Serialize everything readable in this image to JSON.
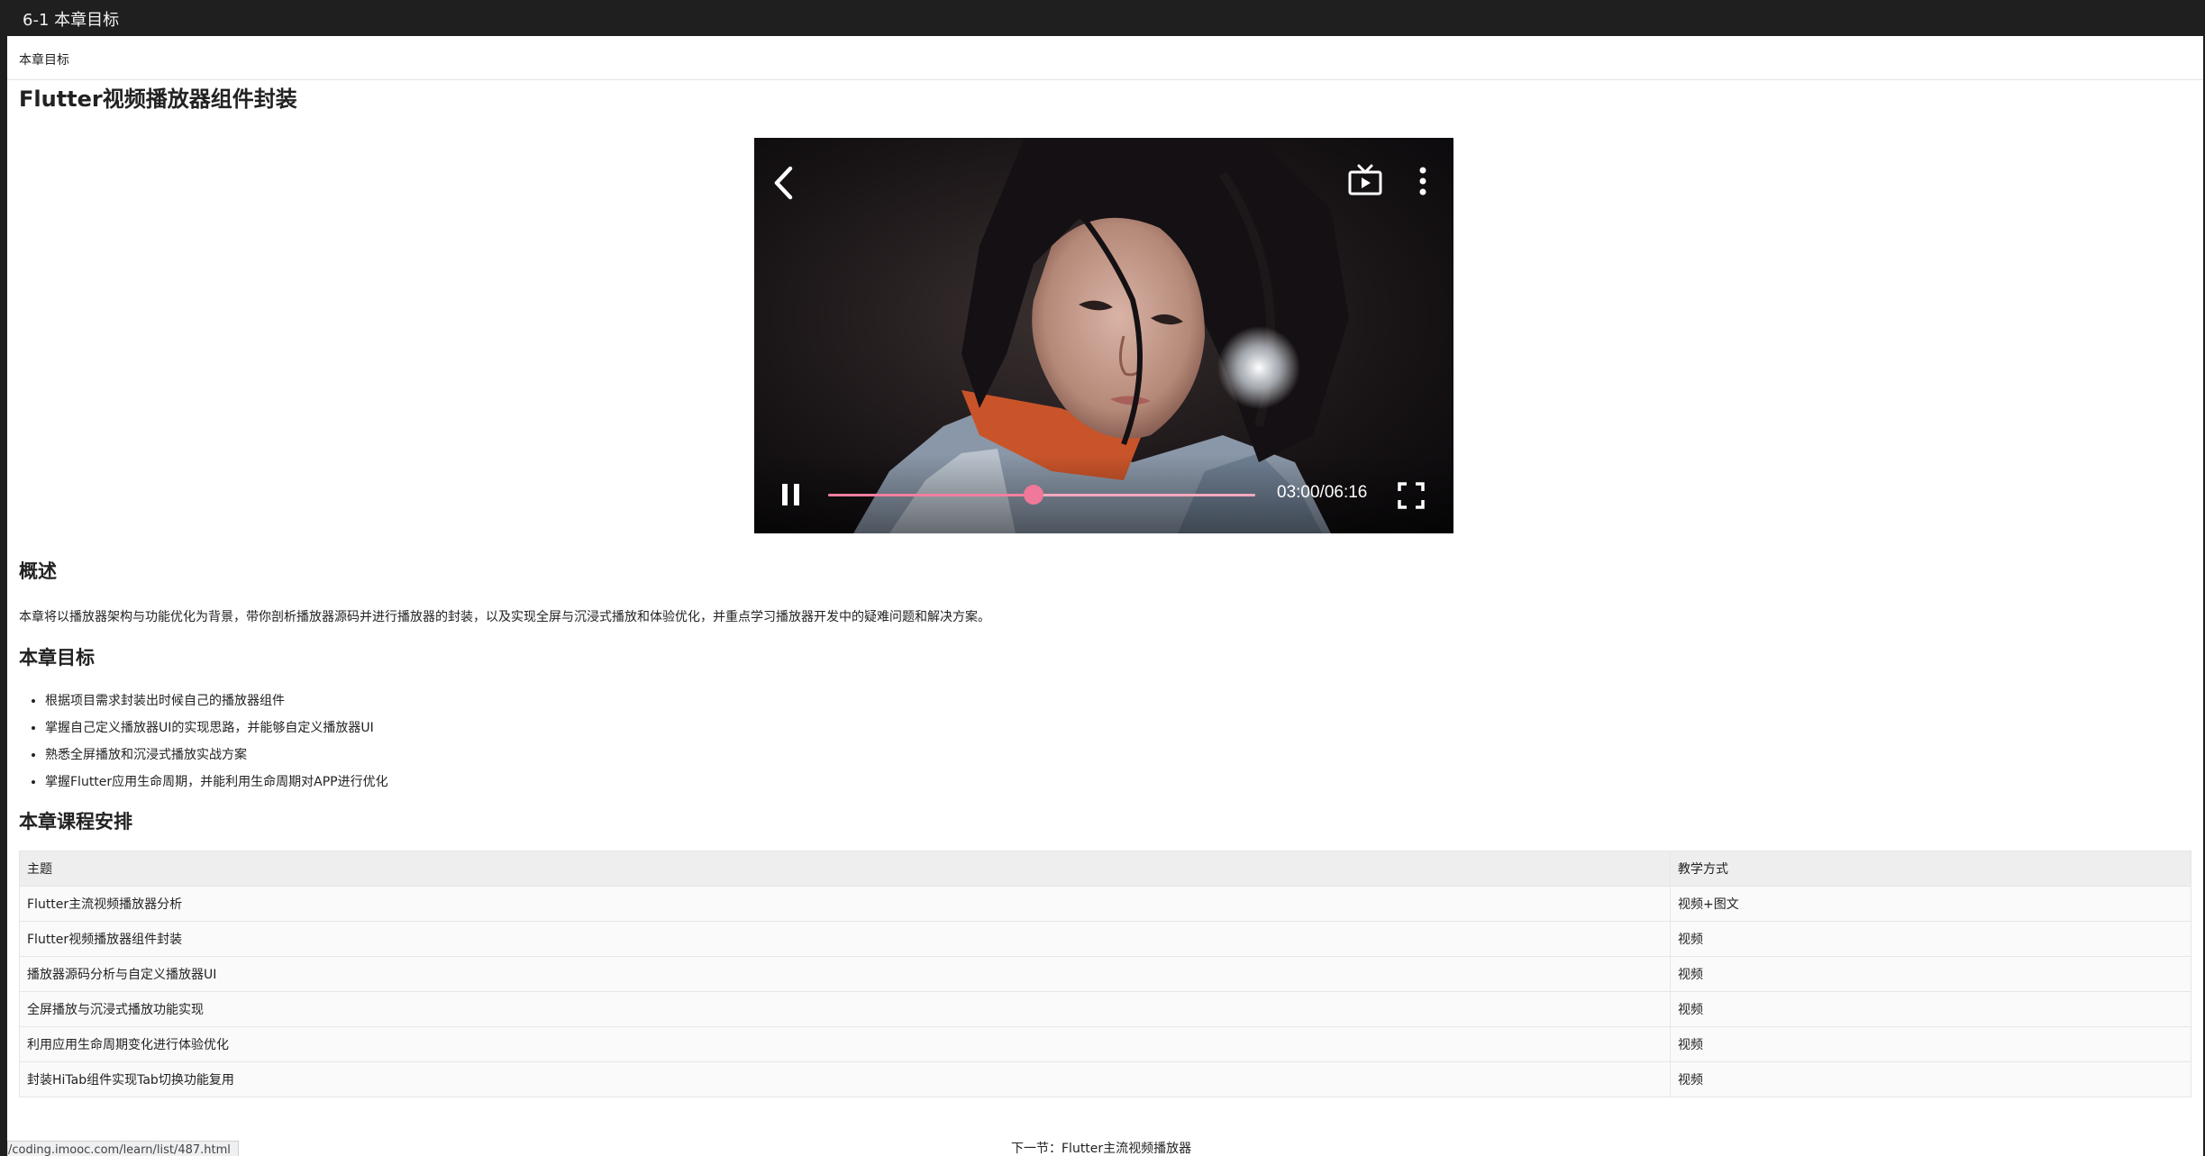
{
  "window": {
    "title": "6-1 本章目标"
  },
  "header": {
    "breadcrumb": "本章目标"
  },
  "main": {
    "title": "Flutter视频播放器组件封装"
  },
  "player": {
    "time": "03:00/06:16",
    "progress_fraction": 0.48,
    "state": "playing",
    "accent_color": "#f07898",
    "icons": [
      "back-icon",
      "tv-cast-icon",
      "more-vert-icon",
      "pause-icon",
      "fullscreen-icon"
    ]
  },
  "overview": {
    "heading": "概述",
    "text": "本章将以播放器架构与功能优化为背景，带你剖析播放器源码并进行播放器的封装，以及实现全屏与沉浸式播放和体验优化，并重点学习播放器开发中的疑难问题和解决方案。"
  },
  "goals": {
    "heading": "本章目标",
    "items": [
      "根据项目需求封装出时候自己的播放器组件",
      "掌握自己定义播放器UI的实现思路，并能够自定义播放器UI",
      "熟悉全屏播放和沉浸式播放实战方案",
      "掌握Flutter应用生命周期，并能利用生命周期对APP进行优化"
    ]
  },
  "schedule": {
    "heading": "本章课程安排",
    "columns": [
      "主题",
      "教学方式"
    ],
    "rows": [
      [
        "Flutter主流视频播放器分析",
        "视频+图文"
      ],
      [
        "Flutter视频播放器组件封装",
        "视频"
      ],
      [
        "播放器源码分析与自定义播放器UI",
        "视频"
      ],
      [
        "全屏播放与沉浸式播放功能实现",
        "视频"
      ],
      [
        "利用应用生命周期变化进行体验优化",
        "视频"
      ],
      [
        "封装HiTab组件实现Tab切换功能复用",
        "视频"
      ]
    ]
  },
  "footer": {
    "next_link": "下一节：Flutter主流视频播放器",
    "status_url": "/coding.imooc.com/learn/list/487.html"
  }
}
